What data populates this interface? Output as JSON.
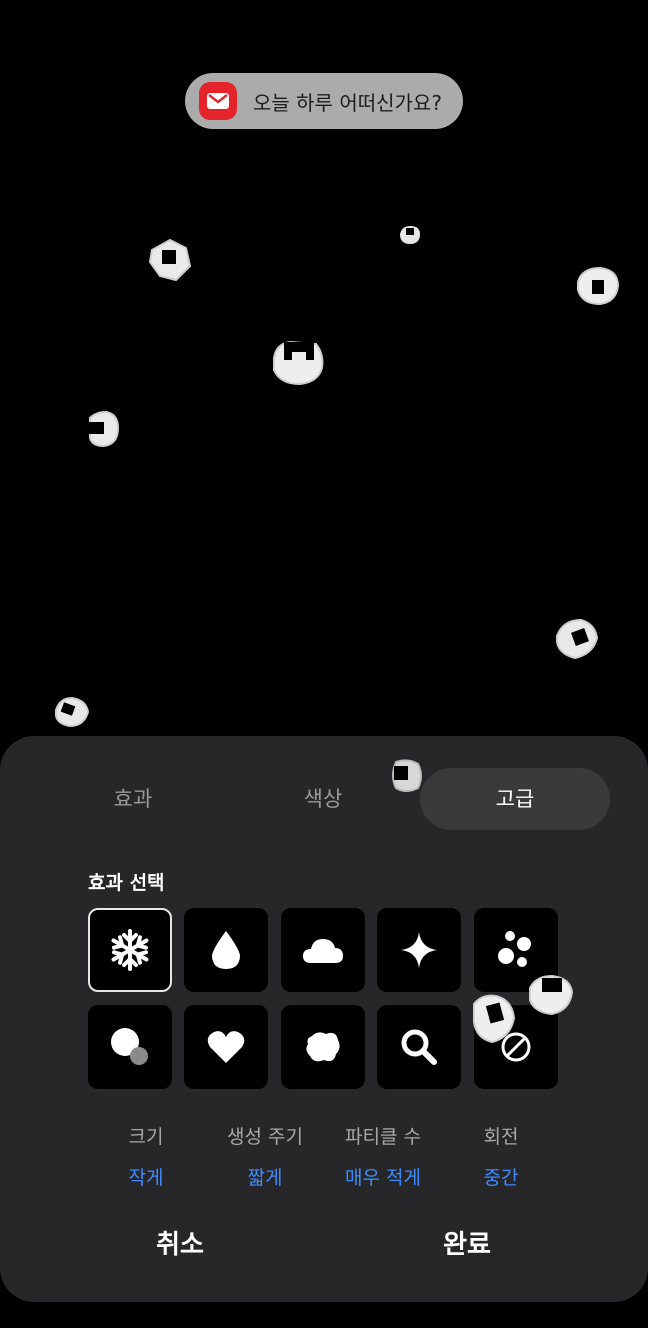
{
  "toast": {
    "app_icon": "mail-icon",
    "message": "오늘 하루 어떠신가요?"
  },
  "sheet": {
    "tabs": [
      {
        "label": "효과",
        "active": false
      },
      {
        "label": "색상",
        "active": false
      },
      {
        "label": "고급",
        "active": true
      }
    ],
    "section_title": "효과 선택",
    "effects": [
      {
        "icon": "snowflake-icon",
        "selected": true
      },
      {
        "icon": "water-drop-icon",
        "selected": false
      },
      {
        "icon": "cloud-icon",
        "selected": false
      },
      {
        "icon": "sparkle-icon",
        "selected": false
      },
      {
        "icon": "bubbles-icon",
        "selected": false
      },
      {
        "icon": "overlapping-circles-icon",
        "selected": false
      },
      {
        "icon": "heart-icon",
        "selected": false
      },
      {
        "icon": "blob-icon",
        "selected": false
      },
      {
        "icon": "magnifier-icon",
        "selected": false
      },
      {
        "icon": "no-effect-icon",
        "selected": false
      }
    ],
    "params": [
      {
        "label": "크기",
        "value": "작게"
      },
      {
        "label": "생성 주기",
        "value": "짧게"
      },
      {
        "label": "파티클 수",
        "value": "매우 적게"
      },
      {
        "label": "회전",
        "value": "중간"
      }
    ],
    "cancel_label": "취소",
    "done_label": "완료"
  },
  "colors": {
    "accent": "#3e8bff",
    "sheet_bg": "#272729",
    "toast_bg": "#ababab",
    "mail_red": "#e5232b"
  }
}
